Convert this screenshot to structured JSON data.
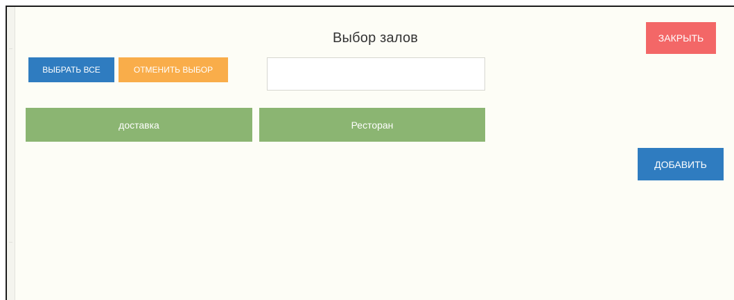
{
  "dialog": {
    "title": "Выбор залов",
    "close_label": "ЗАКРЫТЬ",
    "add_label": "ДОБАВИТЬ"
  },
  "toolbar": {
    "select_all_label": "ВЫБРАТЬ ВСЕ",
    "cancel_selection_label": "ОТМЕНИТЬ ВЫБОР"
  },
  "search": {
    "value": "",
    "placeholder": ""
  },
  "halls": [
    {
      "label": "доставка"
    },
    {
      "label": "Ресторан"
    }
  ],
  "colors": {
    "background": "#fdfdf6",
    "close": "#f36767",
    "primary": "#2f7cc0",
    "warning": "#f9ad4a",
    "hall": "#8bb572"
  }
}
